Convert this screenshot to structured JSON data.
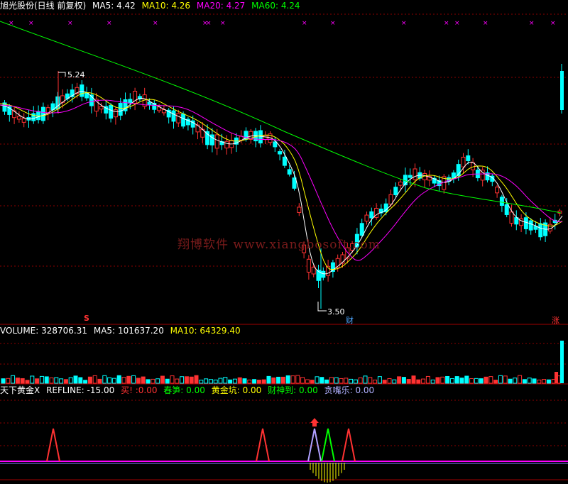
{
  "main": {
    "title": "旭光股份(日线 前复权)",
    "ma5_label": "MA5:",
    "ma5": "4.42",
    "ma10_label": "MA10:",
    "ma10": "4.26",
    "ma20_label": "MA20:",
    "ma20": "4.27",
    "ma60_label": "MA60:",
    "ma60": "4.24",
    "high_label": "5.24",
    "low_label": "3.50",
    "marker_cai": "财",
    "marker_zhang": "涨",
    "marker_s": "S",
    "watermark": "翔博软件 www.xiangbosoft.com"
  },
  "volume": {
    "label": "VOLUME:",
    "value": "328706.31",
    "ma5_label": "MA5:",
    "ma5": "101637.20",
    "ma10_label": "MA10:",
    "ma10": "64329.40"
  },
  "indicator": {
    "name": "天下黄金X",
    "refline_label": "REFLINE:",
    "refline": "-15.00",
    "buy_label": "买!",
    "buy": ":0.00",
    "chunsun_label": "春笋:",
    "chunsun": "0.00",
    "huangjinkeng_label": "黄金坑:",
    "huangjinkeng": "0.00",
    "caishendao_label": "财神到:",
    "caishendao": "0.00",
    "tanzuile_label": "贪嘴乐:",
    "tanzuile": "0.00"
  },
  "colors": {
    "up": "#ff3232",
    "down": "#00ffff",
    "ma5": "#ffffff",
    "ma10": "#ffff00",
    "ma20": "#ff00ff",
    "ma60": "#00ff00",
    "grid": "#8b0000",
    "divider": "#a00000"
  }
}
